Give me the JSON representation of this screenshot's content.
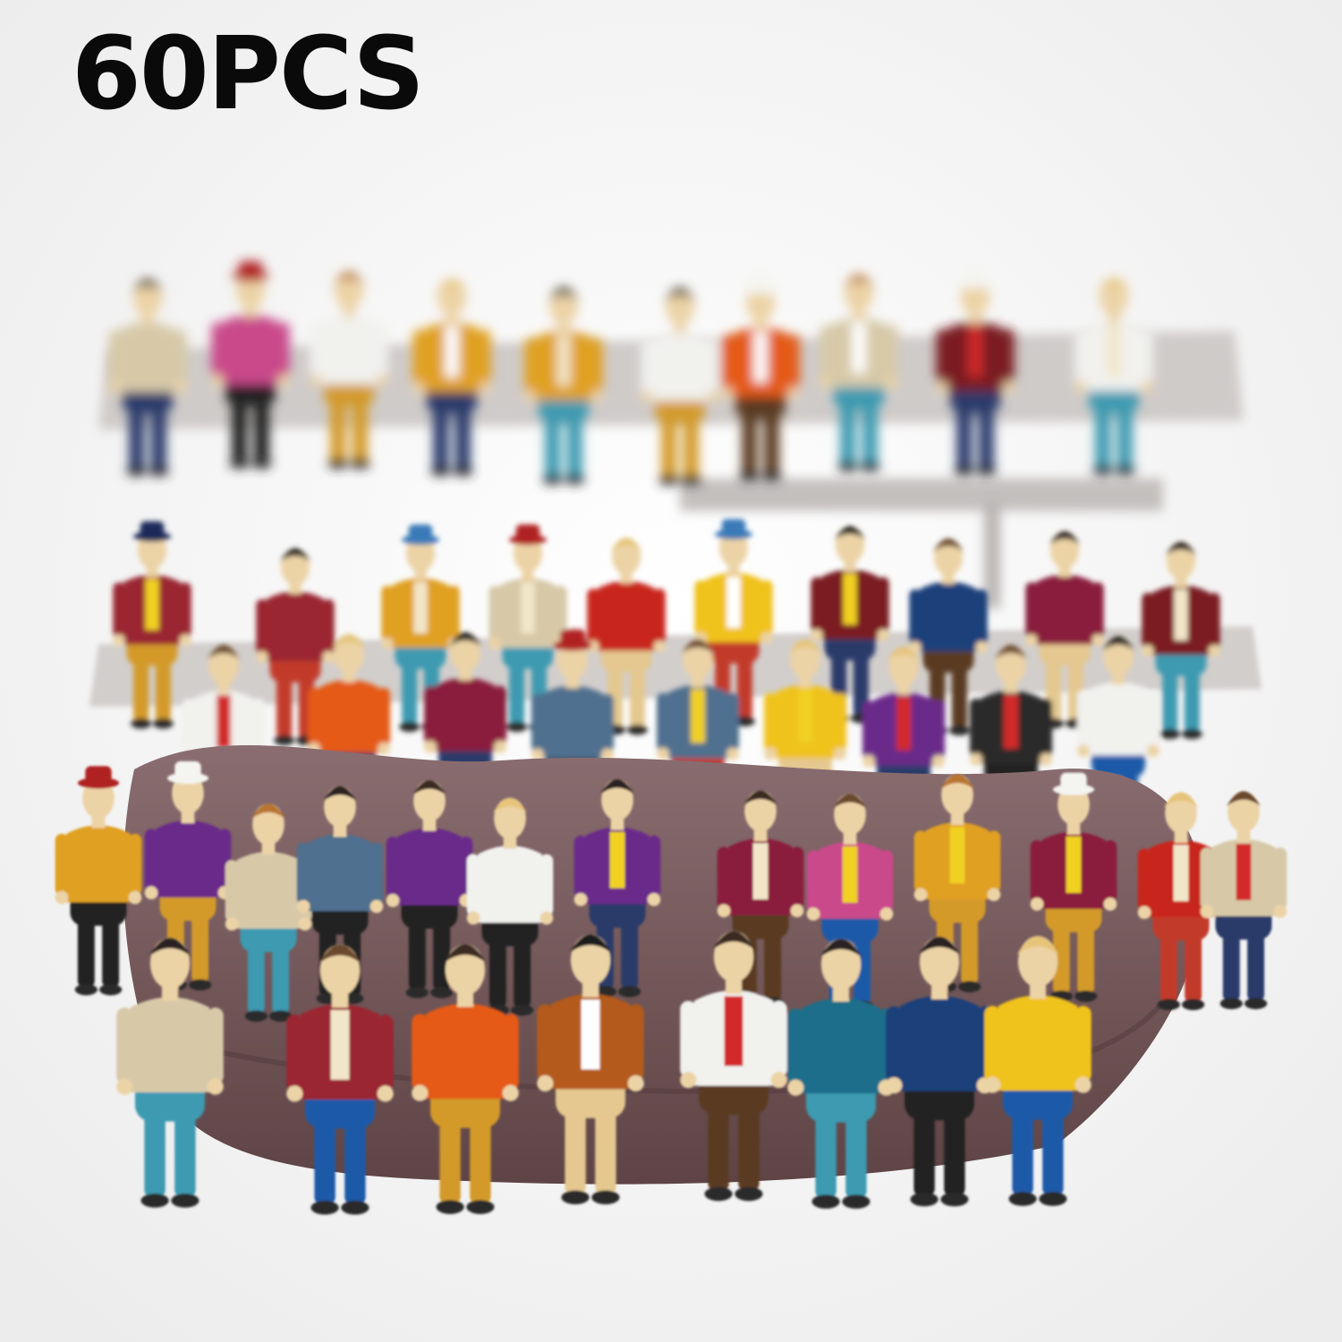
{
  "headline": "60PCS",
  "photo": {
    "subject": "painted-seated-miniature-figures",
    "palette": {
      "background": "#f7f7f7",
      "clay_base": "#7a5c5e",
      "bench": "#c9c6c4",
      "skin": "#ecd3a6"
    }
  }
}
